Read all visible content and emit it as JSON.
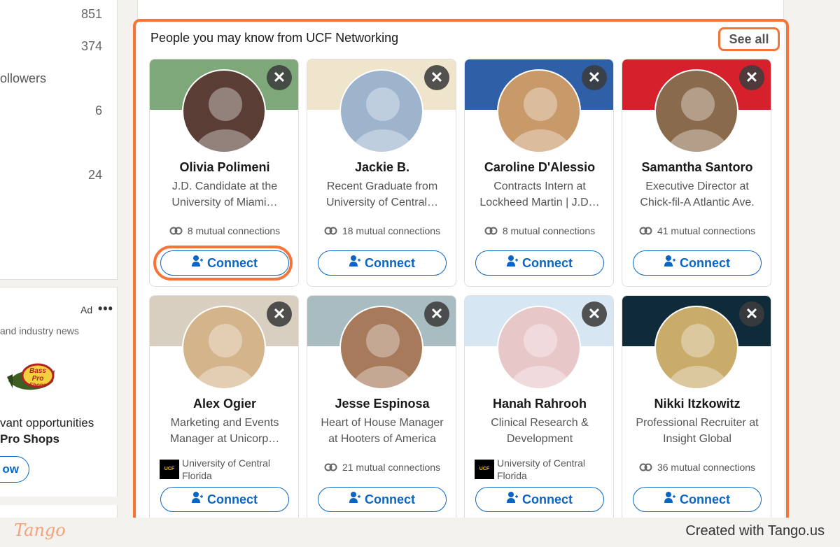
{
  "left_stats": [
    {
      "label": "",
      "value": "851"
    },
    {
      "label": "",
      "value": "374"
    },
    {
      "label": "ollowers",
      "value": ""
    },
    {
      "label": "",
      "value": "6"
    },
    {
      "label": "",
      "value": "24"
    }
  ],
  "ad": {
    "label": "Ad",
    "more": "•••",
    "subtitle": "and industry news",
    "logo_text": "Bass Pro Shops",
    "line1": "vant opportunities",
    "line2": "Pro Shops",
    "follow_label": "ow"
  },
  "section": {
    "title": "People you may know from UCF Networking",
    "see_all": "See all"
  },
  "cards": [
    {
      "name": "Olivia Polimeni",
      "headline": "J.D. Candidate at the University of Miami…",
      "mutual": "8 mutual connections",
      "school": "",
      "banner": "#7fa87a",
      "avatar": "#5a3e36",
      "connect": "Connect"
    },
    {
      "name": "Jackie B.",
      "headline": "Recent Graduate from University of Central…",
      "mutual": "18 mutual connections",
      "school": "",
      "banner": "#efe4cc",
      "avatar": "#9db4cc",
      "connect": "Connect"
    },
    {
      "name": "Caroline D'Alessio",
      "headline": "Contracts Intern at Lockheed Martin | J.D…",
      "mutual": "8 mutual connections",
      "school": "",
      "banner": "#2f5fa6",
      "avatar": "#c89a6a",
      "connect": "Connect"
    },
    {
      "name": "Samantha Santoro",
      "headline": "Executive Director at Chick-fil-A Atlantic Ave.",
      "mutual": "41 mutual connections",
      "school": "",
      "banner": "#d6202b",
      "avatar": "#8a6a4c",
      "connect": "Connect"
    },
    {
      "name": "Alex Ogier",
      "headline": "Marketing and Events Manager at Unicorp…",
      "mutual": "",
      "school": "University of Central Florida",
      "banner": "#d9cfc0",
      "avatar": "#d4b48a",
      "connect": "Connect"
    },
    {
      "name": "Jesse Espinosa",
      "headline": "Heart of House Manager at Hooters of America",
      "mutual": "21 mutual connections",
      "school": "",
      "banner": "#a9bcc2",
      "avatar": "#a67a5a",
      "connect": "Connect"
    },
    {
      "name": "Hanah Rahrooh",
      "headline": "Clinical Research & Development",
      "mutual": "",
      "school": "University of Central Florida",
      "banner": "#d6e6f2",
      "avatar": "#e8c7c8",
      "connect": "Connect"
    },
    {
      "name": "Nikki Itzkowitz",
      "headline": "Professional Recruiter at Insight Global",
      "mutual": "36 mutual connections",
      "school": "",
      "banner": "#0f2b3a",
      "avatar": "#c9ab6a",
      "connect": "Connect"
    }
  ],
  "school_logo_text": "UCF",
  "dismiss_symbol": "✕",
  "footer": {
    "logo": "Tango",
    "created": "Created with Tango.us"
  },
  "colors": {
    "accent_blue": "#0a66c2",
    "highlight_orange": "#f4743a"
  }
}
